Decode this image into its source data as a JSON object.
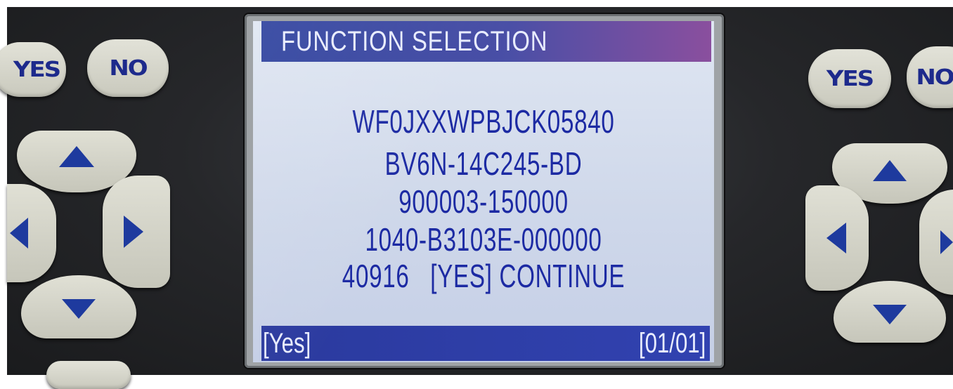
{
  "screen": {
    "title": "FUNCTION SELECTION",
    "lines": [
      "WF0JXXWPBJCK05840",
      "BV6N-14C245-BD",
      "900003-150000",
      "1040-B3103E-000000",
      "40916   [YES] CONTINUE"
    ],
    "status_left": "[Yes]",
    "status_right": "[01/01]"
  },
  "keypad_left": {
    "yes_label": "YES",
    "no_label": "NO"
  },
  "keypad_right": {
    "yes_label": "YES",
    "no_label": "NO"
  },
  "colors": {
    "screen_text": "#1c2aa3",
    "title_bar": "#2a3e9c",
    "key_text": "#1d2a8c"
  }
}
